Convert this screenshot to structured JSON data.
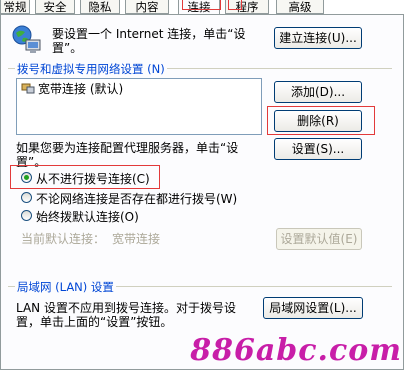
{
  "tabs": [
    {
      "label": "常规"
    },
    {
      "label": "安全"
    },
    {
      "label": "隐私"
    },
    {
      "label": "内容"
    },
    {
      "label": "连接"
    },
    {
      "label": "程序"
    },
    {
      "label": "高级"
    }
  ],
  "active_tab": "连接",
  "setup": {
    "text": "要设置一个 Internet 连接，单击“设置”。",
    "button": "建立连接(U)..."
  },
  "dialup_group": {
    "title": "拨号和虚拟专用网络设置 (N)",
    "connections": [
      {
        "label": "宽带连接 (默认)"
      }
    ],
    "add_button": "添加(D)...",
    "remove_button": "删除(R)",
    "settings_button": "设置(S)...",
    "proxy_text": "如果您要为连接配置代理服务器，单击“设置”。",
    "options": [
      {
        "label": "从不进行拨号连接(C)",
        "checked": true
      },
      {
        "label": "不论网络连接是否存在都进行拨号(W)",
        "checked": false
      },
      {
        "label": "始终拨默认连接(O)",
        "checked": false
      }
    ],
    "current_default_label": "当前默认连接：",
    "current_default_value": "宽带连接",
    "set_default_button": "设置默认值(E)"
  },
  "lan_group": {
    "title": "局域网 (LAN) 设置",
    "text": "LAN 设置不应用到拨号连接。对于拨号设置，单击上面的“设置”按钮。",
    "button": "局域网设置(L)..."
  },
  "watermark": "886abc.com",
  "colors": {
    "highlight_box": "#e23a3a",
    "group_title": "#0046d5",
    "radio_dot": "#21a121",
    "watermark": "#c81ea8"
  }
}
